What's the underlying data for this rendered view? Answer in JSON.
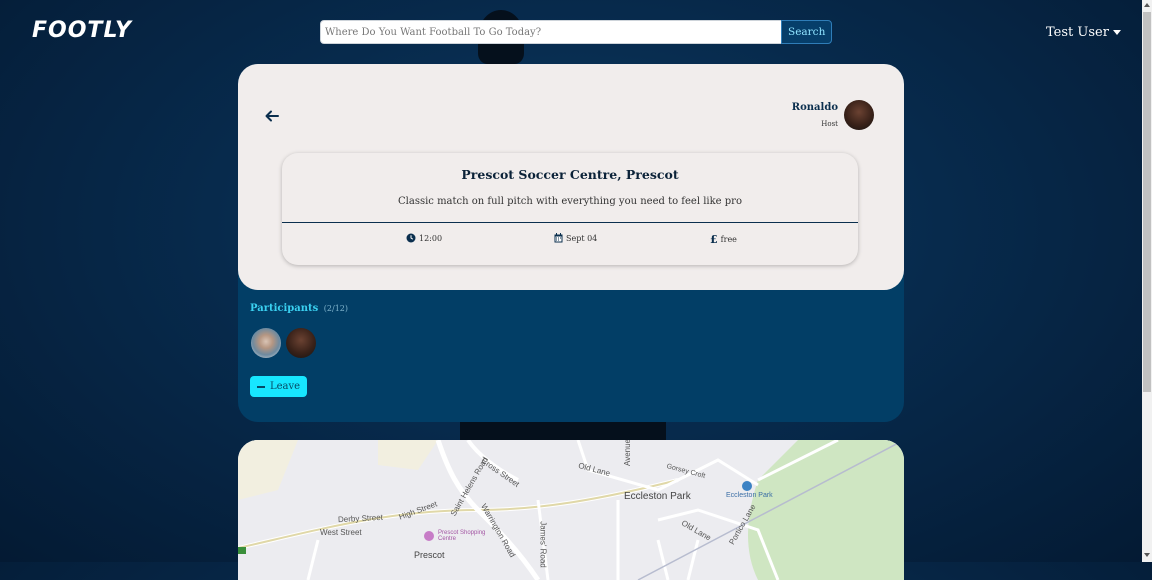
{
  "nav": {
    "logo": "FOOTLY",
    "search_placeholder": "Where Do You Want Football To Go Today?",
    "search_label": "Search",
    "user_name": "Test User"
  },
  "event": {
    "host_name": "Ronaldo",
    "host_label": "Host",
    "venue": "Prescot Soccer Centre, Prescot",
    "description": "Classic match on full pitch with everything you need to feel like pro",
    "time": "12:00",
    "date": "Sept 04",
    "price": "free"
  },
  "participants": {
    "label": "Participants",
    "count": "(2/12)",
    "leave_label": "Leave"
  },
  "map": {
    "labels": {
      "old_lane": "Old Lane",
      "gorsey_croft": "Gorsey Croft",
      "eccleston_park_area": "Eccleston Park",
      "eccleston_park_station": "Eccleston Park",
      "cross_street": "Cross Street",
      "saint_helens_road": "Saint Helens Road",
      "derby_street": "Derby Street",
      "high_street": "High Street",
      "warrington_road": "Warrington Road",
      "west_street": "West Street",
      "prescot_shopping_centre": "Prescot Shopping Centre",
      "prescot": "Prescot",
      "old_lane_2": "Old Lane",
      "portico_lane": "Portico Lane",
      "james_road": "James' Road",
      "avenue": "Avenue"
    }
  },
  "colors": {
    "accent": "#17e6ff",
    "card": "#f1edec",
    "panel": "#023e66"
  }
}
